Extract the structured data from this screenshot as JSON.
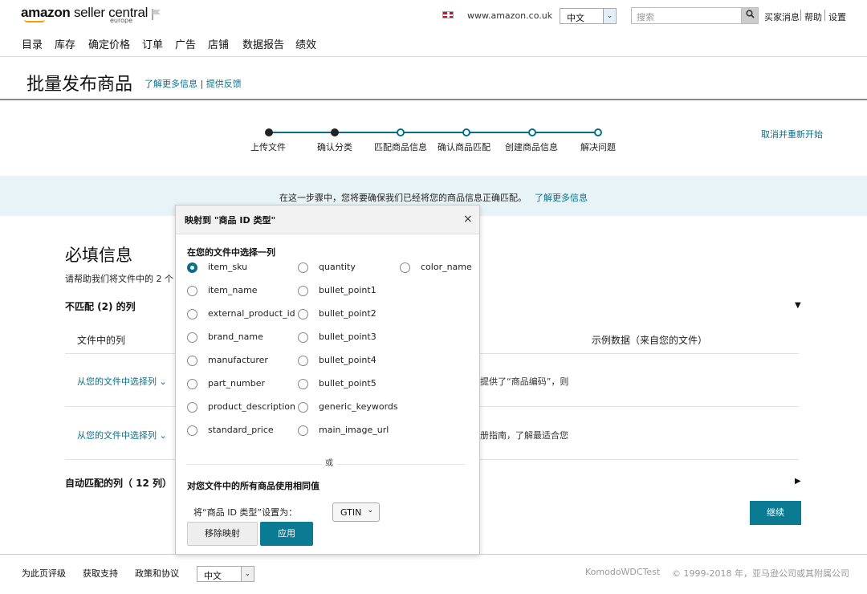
{
  "header": {
    "logo_brand": "amazon",
    "logo_product": "seller central",
    "logo_sub": "europe",
    "marketplace": "www.amazon.co.uk",
    "language": "中文",
    "search_placeholder": "搜索",
    "links": [
      "买家消息",
      "帮助",
      "设置"
    ]
  },
  "nav": [
    "目录",
    "库存",
    "确定价格",
    "订单",
    "广告",
    "店铺",
    "数据报告",
    "绩效"
  ],
  "page": {
    "title": "批量发布商品",
    "learn_more": "了解更多信息",
    "divider": "|",
    "feedback": "提供反馈"
  },
  "progress": {
    "steps": [
      "上传文件",
      "确认分类",
      "匹配商品信息",
      "确认商品匹配",
      "创建商品信息",
      "解决问题"
    ],
    "restart": "取消并重新开始"
  },
  "banner": {
    "text": "在这一步骤中，您将要确保我们已经将您的商品信息正确匹配。",
    "link": "了解更多信息"
  },
  "main": {
    "required_title": "必填信息",
    "help_text": "请帮助我们将文件中的 2 个",
    "unmatched_title": "不匹配 (2) 的列",
    "col_file": "文件中的列",
    "col_sample": "示例数据（来自您的文件）",
    "rows": [
      {
        "choose": "从您的文件中选择列",
        "note": "提供了“商品编码”，则"
      },
      {
        "choose": "从您的文件中选择列",
        "note": "册指南，了解最适合您"
      }
    ],
    "auto_title": "自动匹配的列（ 12 列）",
    "continue": "继续"
  },
  "modal": {
    "title": "映射到 \"商品 ID 类型\"",
    "close": "×",
    "section1": "在您的文件中选择一列",
    "options": [
      [
        "item_sku",
        "quantity",
        "color_name"
      ],
      [
        "item_name",
        "bullet_point1"
      ],
      [
        "external_product_id",
        "bullet_point2"
      ],
      [
        "brand_name",
        "bullet_point3"
      ],
      [
        "manufacturer",
        "bullet_point4"
      ],
      [
        "part_number",
        "bullet_point5"
      ],
      [
        "product_description",
        "generic_keywords"
      ],
      [
        "standard_price",
        "main_image_url"
      ]
    ],
    "selected": "item_sku",
    "or": "或",
    "section2": "对您文件中的所有商品使用相同值",
    "set_label": "将“商品 ID 类型”设置为：",
    "set_value": "GTIN",
    "remove": "移除映射",
    "apply": "应用"
  },
  "footer": {
    "links": [
      "为此页评级",
      "获取支持",
      "政策和协议"
    ],
    "language": "中文",
    "account": "KomodoWDCTest",
    "copyright": "© 1999-2018 年，亚马逊公司或其附属公司"
  },
  "colors": {
    "accent": "#0a6f86",
    "button": "#0a7b92",
    "banner": "#e7f3f6"
  }
}
